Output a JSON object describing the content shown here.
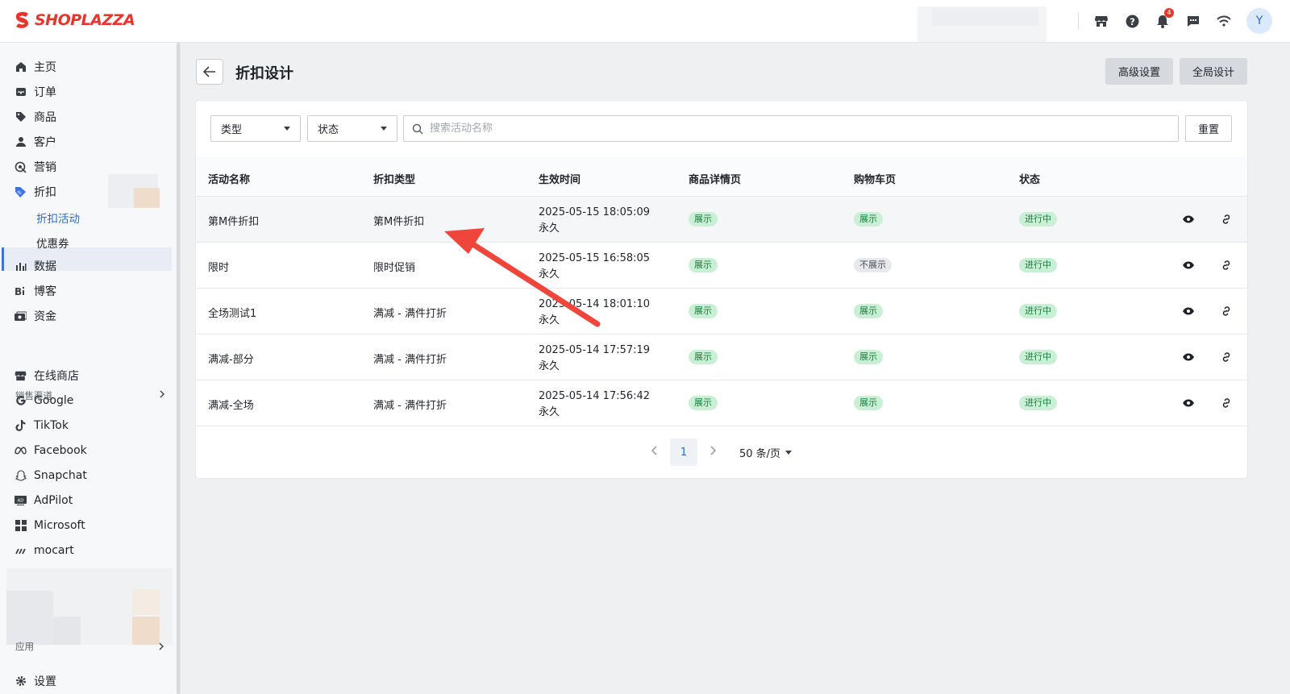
{
  "brand": {
    "name": "SHOPLAZZA",
    "accent": "#e8352c"
  },
  "topbar": {
    "notification_count": "4",
    "avatar_initial": "Y",
    "icons": [
      "store-icon",
      "help-icon",
      "bell-icon",
      "chat-icon",
      "wifi-icon"
    ]
  },
  "sidebar": {
    "items": [
      {
        "label": "主页",
        "icon": "home-icon"
      },
      {
        "label": "订单",
        "icon": "orders-icon"
      },
      {
        "label": "商品",
        "icon": "tag-icon"
      },
      {
        "label": "客户",
        "icon": "person-icon"
      },
      {
        "label": "营销",
        "icon": "marketing-icon"
      },
      {
        "label": "折扣",
        "icon": "discount-icon"
      }
    ],
    "sub_items": [
      {
        "label": "折扣活动",
        "active": true
      },
      {
        "label": "优惠券",
        "active": false
      }
    ],
    "items2": [
      {
        "label": "数据",
        "icon": "chart-icon"
      },
      {
        "label": "博客",
        "icon": "blog-icon"
      },
      {
        "label": "资金",
        "icon": "wallet-icon"
      }
    ],
    "section_label": "销售渠道",
    "channels": [
      {
        "label": "在线商店",
        "icon": "store-icon"
      },
      {
        "label": "Google",
        "icon": "google-icon"
      },
      {
        "label": "TikTok",
        "icon": "tiktok-icon"
      },
      {
        "label": "Facebook",
        "icon": "meta-icon"
      },
      {
        "label": "Snapchat",
        "icon": "snapchat-icon"
      },
      {
        "label": "AdPilot",
        "icon": "adpilot-icon"
      },
      {
        "label": "Microsoft",
        "icon": "microsoft-icon"
      },
      {
        "label": "mocart",
        "icon": "mocart-icon"
      }
    ],
    "apps_label": "应用",
    "settings_label": "设置"
  },
  "page": {
    "title": "折扣设计",
    "advanced_button": "高级设置",
    "global_button": "全局设计"
  },
  "filters": {
    "type_label": "类型",
    "status_label": "状态",
    "search_placeholder": "搜索活动名称",
    "reset_label": "重置"
  },
  "table": {
    "headers": [
      "活动名称",
      "折扣类型",
      "生效时间",
      "商品详情页",
      "购物车页",
      "状态"
    ],
    "rows": [
      {
        "name": "第M件折扣",
        "type": "第M件折扣",
        "start": "2025-05-15 18:05:09",
        "end": "永久",
        "detail": "展示",
        "cart": "展示",
        "status": "进行中"
      },
      {
        "name": "限时",
        "type": "限时促销",
        "start": "2025-05-15 16:58:05",
        "end": "永久",
        "detail": "展示",
        "cart": "不展示",
        "status": "进行中"
      },
      {
        "name": "全场测试1",
        "type": "满减 - 满件打折",
        "start": "2025-05-14 18:01:10",
        "end": "永久",
        "detail": "展示",
        "cart": "展示",
        "status": "进行中"
      },
      {
        "name": "满减-部分",
        "type": "满减 - 满件打折",
        "start": "2025-05-14 17:57:19",
        "end": "永久",
        "detail": "展示",
        "cart": "展示",
        "status": "进行中"
      },
      {
        "name": "满减-全场",
        "type": "满减 - 满件打折",
        "start": "2025-05-14 17:56:42",
        "end": "永久",
        "detail": "展示",
        "cart": "展示",
        "status": "进行中"
      }
    ]
  },
  "pagination": {
    "current_page": "1",
    "page_size_label": "50 条/页"
  },
  "colors": {
    "link_blue": "#2a6ec9",
    "tag_green": "#c9efd5",
    "arrow_red": "#f0453a"
  }
}
